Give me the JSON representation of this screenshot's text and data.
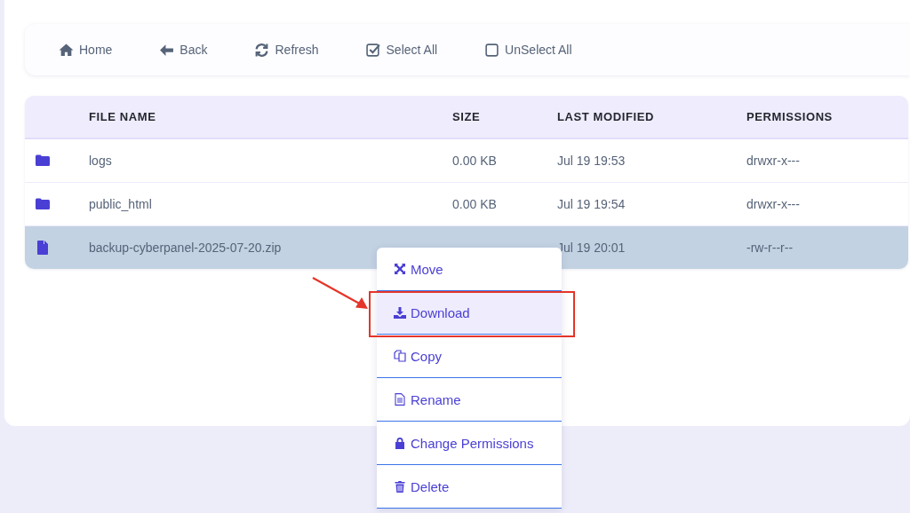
{
  "toolbar": [
    {
      "kind": "home",
      "label": "Home"
    },
    {
      "kind": "back",
      "label": "Back"
    },
    {
      "kind": "refresh",
      "label": "Refresh"
    },
    {
      "kind": "select",
      "label": "Select All"
    },
    {
      "kind": "unselect",
      "label": "UnSelect All"
    }
  ],
  "table": {
    "columns": [
      "FILE NAME",
      "SIZE",
      "LAST MODIFIED",
      "PERMISSIONS"
    ],
    "rows": [
      {
        "kind": "folder",
        "name": "logs",
        "size": "0.00 KB",
        "modified": "Jul 19 19:53",
        "permissions": "drwxr-x---",
        "selected": false
      },
      {
        "kind": "folder",
        "name": "public_html",
        "size": "0.00 KB",
        "modified": "Jul 19 19:54",
        "permissions": "drwxr-x---",
        "selected": false
      },
      {
        "kind": "file",
        "name": "backup-cyberpanel-2025-07-20.zip",
        "modified": "Jul 19 20:01",
        "permissions": "-rw-r--r--",
        "selected": true
      }
    ]
  },
  "context_menu": [
    {
      "kind": "move",
      "label": "Move",
      "selected": false
    },
    {
      "kind": "download",
      "label": "Download",
      "selected": true
    },
    {
      "kind": "copy",
      "label": "Copy",
      "selected": false
    },
    {
      "kind": "rename",
      "label": "Rename",
      "selected": false
    },
    {
      "kind": "lock",
      "label": "Change Permissions",
      "selected": false
    },
    {
      "kind": "delete",
      "label": "Delete",
      "selected": false
    }
  ]
}
